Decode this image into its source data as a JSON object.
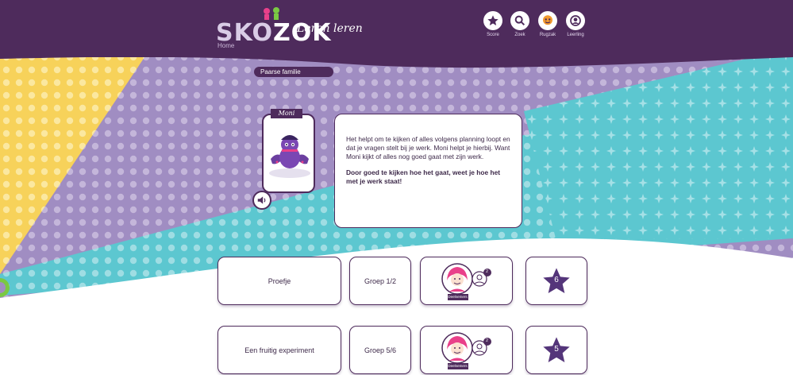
{
  "header": {
    "logo_part1": "SKO",
    "logo_part2": "ZOK",
    "tagline": "Leren leren",
    "breadcrumb": "Home",
    "nav": [
      {
        "label": "Score",
        "icon": "star-icon"
      },
      {
        "label": "Zoek",
        "icon": "search-icon"
      },
      {
        "label": "Rugzak",
        "icon": "backpack-icon"
      },
      {
        "label": "Leerling",
        "icon": "user-icon"
      }
    ]
  },
  "family_label": "Paarse familie",
  "character": {
    "name": "Moni",
    "paragraph1": "Het helpt om te kijken of alles volgens planning loopt en dat je vragen stelt bij je werk. Moni helpt je hierbij. Want Moni kijkt of alles nog goed gaat met zijn werk.",
    "paragraph2": "Door goed te kijken hoe het gaat, weet je hoe het met je werk staat!"
  },
  "lessons": [
    {
      "title": "Proefje",
      "group": "Groep 1/2",
      "badge_count": "2",
      "badge_label": "Deelnemers",
      "stars": "6"
    },
    {
      "title": "Een fruitig experiment",
      "group": "Groep 5/6",
      "badge_count": "2",
      "badge_label": "Deelnemers",
      "stars": "5"
    }
  ],
  "colors": {
    "header": "#4e2b5c",
    "yellow": "#f7d25a",
    "purple": "#9f8cc0",
    "teal": "#5bc6cf",
    "star": "#54357a"
  }
}
